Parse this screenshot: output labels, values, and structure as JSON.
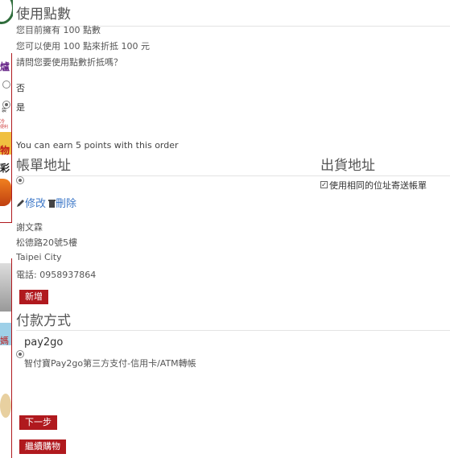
{
  "points_section": {
    "title": "使用點數",
    "owned_text": "您目前擁有 100 點數",
    "redeem_text": "您可以使用 100 點來折抵 100 元",
    "question_text": "請問您要使用點數折抵嗎？",
    "options": [
      "否",
      "是"
    ],
    "earn_text": "You can earn 5 points with this order"
  },
  "billing": {
    "title": "帳單地址",
    "edit_label": "修改",
    "delete_label": "刪除",
    "name": "謝文霖",
    "street": "松德路20號5樓",
    "city": "Taipei City",
    "phone": "電話: 0958937864",
    "add_label": "新增"
  },
  "shipping": {
    "title": "出貨地址",
    "same_address_label": "使用相同的位址寄送帳單"
  },
  "payment": {
    "title": "付款方式",
    "method_name": "pay2go",
    "method_desc": "智付寶Pay2go第三方支付-信用卡/ATM轉帳"
  },
  "actions": {
    "next_label": "下一步",
    "continue_label": "繼續購物"
  },
  "left_ad": {
    "char_top": "爐",
    "char_mid1": "物",
    "char_mid2": "彩",
    "char_low": "媽",
    "small1": "袋",
    "small2": "冷",
    "small3": "便利"
  },
  "colors": {
    "accent": "#b0191e",
    "link": "#3d78c8"
  }
}
